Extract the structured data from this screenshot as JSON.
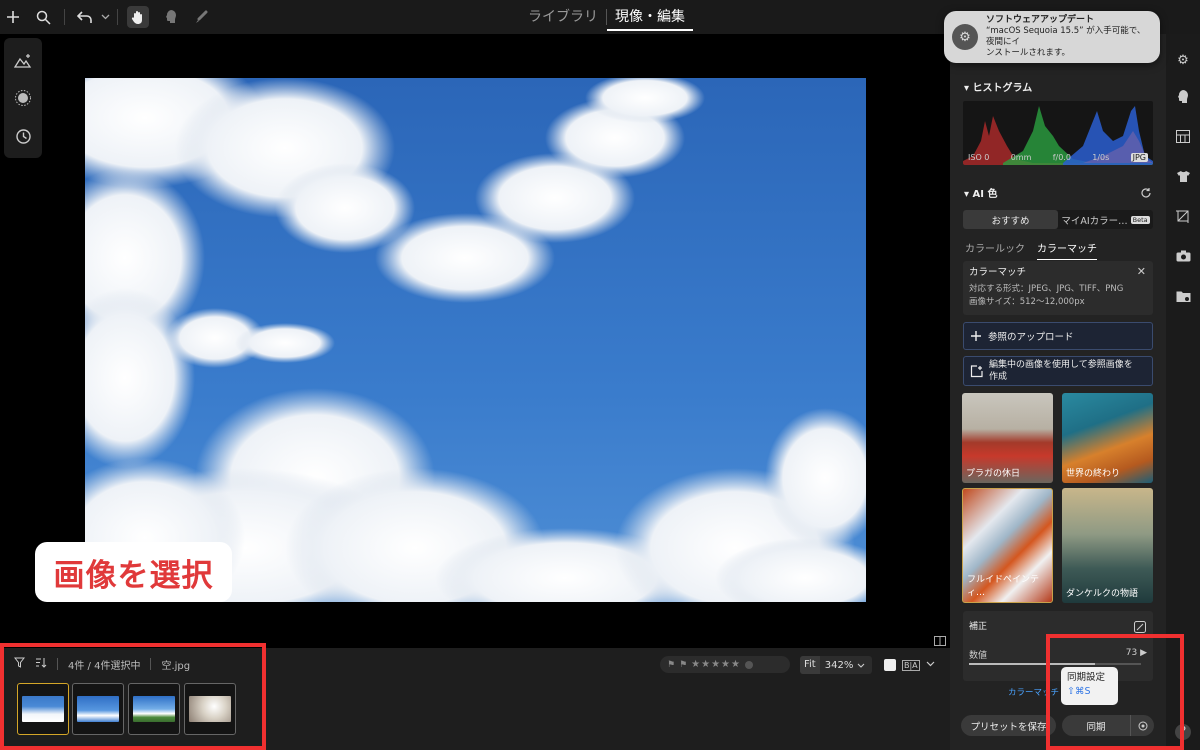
{
  "topbar": {
    "icons": [
      "plus-icon",
      "search-icon",
      "undo-icon",
      "hand-icon",
      "face-icon",
      "brush-icon"
    ],
    "tabs": [
      {
        "label": "ライブラリ",
        "active": false
      },
      {
        "label": "現像・編集",
        "active": true
      }
    ]
  },
  "left_tools": [
    "landscape-sparkle-icon",
    "circle-sparkle-icon",
    "history-icon"
  ],
  "annotation": {
    "label": "画像を選択",
    "color": "#e0393a"
  },
  "filmstrip": {
    "count_label": "4件 / 4件選択中",
    "filename": "空.jpg",
    "thumbnails": [
      {
        "selected": true
      },
      {
        "selected": false
      },
      {
        "selected": false
      },
      {
        "selected": false
      }
    ]
  },
  "view": {
    "fit_label": "Fit",
    "zoom_label": "342%",
    "compare_label": "B|A"
  },
  "notification": {
    "title": "ソフトウェアアップデート",
    "body_line1": "“macOS Sequoia 15.5” が入手可能で、夜間にイ",
    "body_line2": "ンストールされます。"
  },
  "panel": {
    "histogram": {
      "title": "ヒストグラム",
      "iso": "ISO 0",
      "focal": "0mm",
      "aperture": "f/0.0",
      "shutter": "1/0s",
      "format": "JPG"
    },
    "ai_color": {
      "title": "AI 色",
      "seg_recommended": "おすすめ",
      "seg_my": "マイAIカラー…",
      "beta": "Beta",
      "tab_look": "カラールック",
      "tab_match": "カラーマッチ",
      "info_title": "カラーマッチ",
      "info_line1": "対応する形式：JPEG、JPG、TIFF、PNG",
      "info_line2": "画像サイズ：512〜12,000px",
      "upload_label": "参照のアップロード",
      "create_line1": "編集中の画像を使用して参照画像を",
      "create_line2": "作成",
      "presets": [
        {
          "label": "プラガの休日"
        },
        {
          "label": "世界の終わり"
        },
        {
          "label": "フルイドペインティ…"
        },
        {
          "label": "ダンケルクの物語"
        }
      ]
    },
    "adjust": {
      "title": "補正",
      "amount_label": "数値",
      "amount_value": "73",
      "amount_fraction": 0.73
    },
    "link_label": "カラーマッチ",
    "tooltip": {
      "title": "同期設定",
      "shortcut": "⇧⌘S"
    },
    "save_preset_label": "プリセットを保存",
    "sync_label": "同期"
  },
  "colors": {
    "accent_blue": "#4aa3ff",
    "highlight": "#f03030",
    "selected": "#d4a628"
  }
}
